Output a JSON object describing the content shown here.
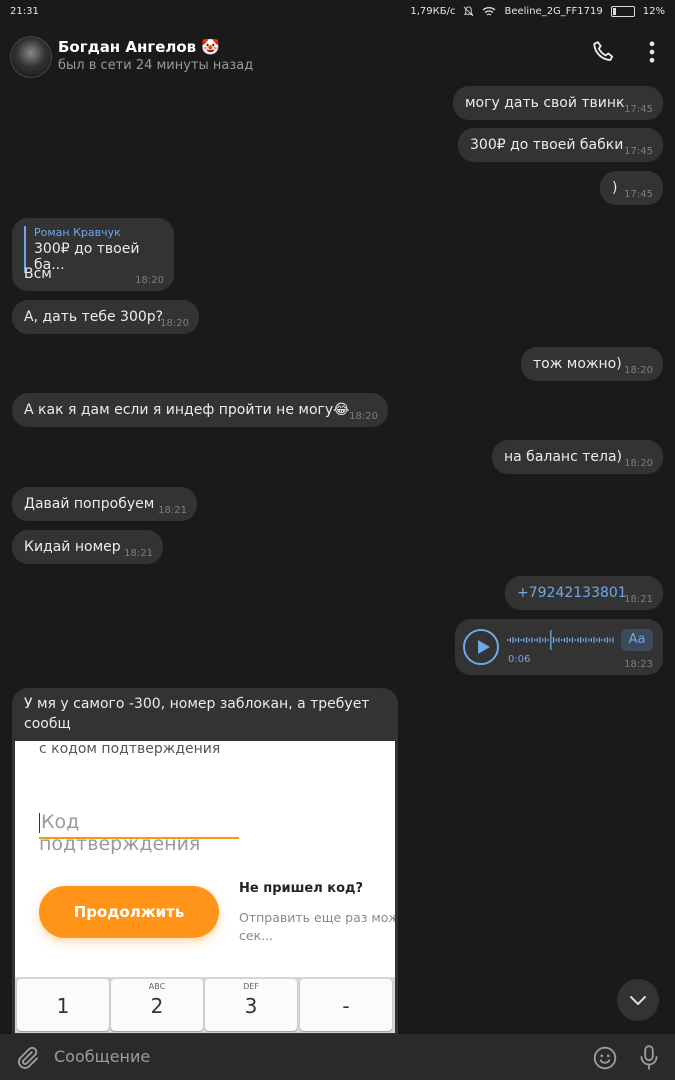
{
  "status_bar": {
    "time": "21:31",
    "speed": "1,79КБ/с",
    "network": "Beeline_2G_FF1719",
    "battery": "12%"
  },
  "header": {
    "name": "Богдан Ангелов 🤡",
    "status": "был в сети 24 минуты назад",
    "call_icon": "phone-icon",
    "menu_icon": "more-vertical-icon"
  },
  "messages": [
    {
      "dir": "out",
      "text": "могу дать свой твинк",
      "time": "17:45"
    },
    {
      "dir": "out",
      "text": "300₽ до твоей бабки",
      "time": "17:45"
    },
    {
      "dir": "out",
      "text": ")",
      "time": "17:45"
    },
    {
      "dir": "in",
      "reply_name": "Роман Кравчук",
      "reply_text": "300₽ до твоей ба...",
      "text": "Всм",
      "time": "18:20"
    },
    {
      "dir": "in",
      "text": "А, дать тебе 300р?",
      "time": "18:20"
    },
    {
      "dir": "out",
      "text": "тож можно)",
      "time": "18:20"
    },
    {
      "dir": "in",
      "text": "А как я дам если я индеф пройти не могу😂",
      "time": "18:20"
    },
    {
      "dir": "out",
      "text": "на баланс тела)",
      "time": "18:20"
    },
    {
      "dir": "in",
      "text": "Давай попробуем",
      "time": "18:21"
    },
    {
      "dir": "in",
      "text": "Кидай номер",
      "time": "18:21"
    },
    {
      "dir": "out",
      "text": "+79242133801",
      "time": "18:21"
    },
    {
      "dir": "out",
      "type": "voice",
      "duration": "0:06",
      "time": "18:23",
      "aa": "Аа"
    },
    {
      "dir": "in",
      "text_line1": "У мя у самого -300, номер заблокан, а требует",
      "text_line2": "сообщ"
    }
  ],
  "embedded_image": {
    "top_text": "с кодом подтверждения",
    "field_placeholder": "Код подтверждения",
    "continue_button": "Продолжить",
    "no_code": "Не пришел код?",
    "resend_line1": "Отправить еще раз мож",
    "resend_line2": "сек...",
    "keys": [
      {
        "sub": "",
        "main": "1"
      },
      {
        "sub": "ABC",
        "main": "2"
      },
      {
        "sub": "DEF",
        "main": "3"
      },
      {
        "sub": "",
        "main": "-"
      }
    ]
  },
  "input": {
    "placeholder": "Сообщение"
  },
  "colors": {
    "background": "#1a1a1a",
    "bubble": "#333333",
    "accent": "#6fa8e8",
    "orange": "#ff9418"
  }
}
